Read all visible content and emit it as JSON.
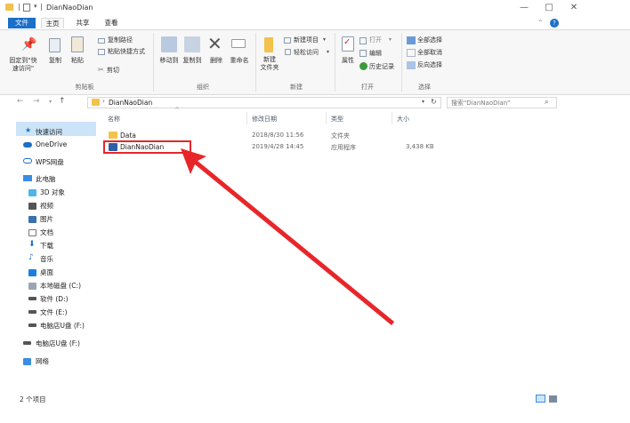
{
  "window": {
    "title": "DianNaoDian",
    "controls": {
      "minimize": "—",
      "maximize": "□",
      "close": "✕"
    }
  },
  "tabs": {
    "file": "文件",
    "home": "主页",
    "share": "共享",
    "view": "查看"
  },
  "ribbon": {
    "clipboard": {
      "pin_label": "固定到\"快\n速访问\"",
      "copy_label": "复制",
      "paste_label": "粘贴",
      "copy_path": "复制路径",
      "paste_shortcut": "粘贴快捷方式",
      "cut": "剪切",
      "group": "剪贴板"
    },
    "organize": {
      "move_to": "移动到",
      "copy_to": "复制到",
      "delete": "删除",
      "rename": "重命名",
      "group": "组织"
    },
    "new": {
      "new_folder": "新建\n文件夹",
      "new_item": "新建项目",
      "easy_access": "轻松访问",
      "group": "新建"
    },
    "open": {
      "properties": "属性",
      "open": "打开",
      "edit": "编辑",
      "history": "历史记录",
      "group": "打开"
    },
    "select": {
      "select_all": "全部选择",
      "select_none": "全部取消",
      "invert": "反向选择",
      "group": "选择"
    }
  },
  "address": {
    "path": "DianNaoDian",
    "search_placeholder": "搜索\"DianNaoDian\""
  },
  "sidebar": {
    "quick_access": "快速访问",
    "onedrive": "OneDrive",
    "wps": "WPS网盘",
    "this_pc": "此电脑",
    "items": [
      "3D 对象",
      "视频",
      "图片",
      "文档",
      "下载",
      "音乐",
      "桌面",
      "本地磁盘 (C:)",
      "软件 (D:)",
      "文件 (E:)",
      "电脑店U盘 (F:)"
    ],
    "usb": "电脑店U盘 (F:)",
    "network": "网络"
  },
  "columns": {
    "name": "名称",
    "modified": "修改日期",
    "type": "类型",
    "size": "大小"
  },
  "files": [
    {
      "name": "Data",
      "modified": "2018/8/30 11:56",
      "type": "文件夹",
      "size": ""
    },
    {
      "name": "DianNaoDian",
      "modified": "2019/4/28 14:45",
      "type": "应用程序",
      "size": "3,438 KB"
    }
  ],
  "status": {
    "count": "2 个项目"
  },
  "colors": {
    "accent": "#1a6fc9",
    "highlight": "#e8262a",
    "folder": "#f2c24c"
  }
}
